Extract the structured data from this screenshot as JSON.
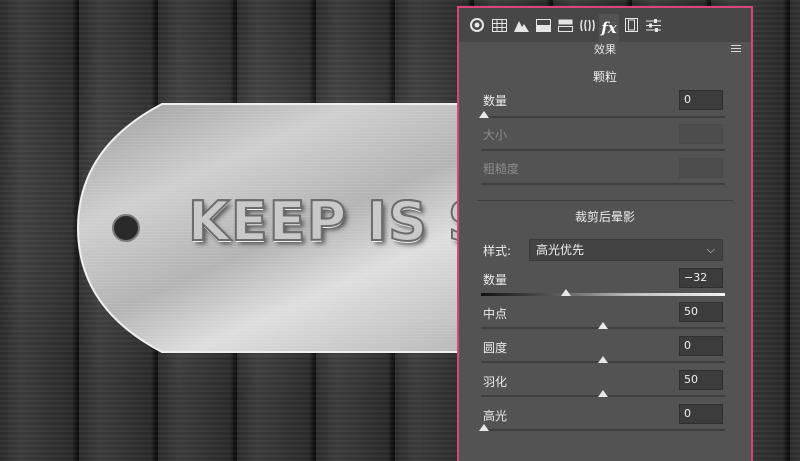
{
  "tag": {
    "text": "KEEP IS SI"
  },
  "panel": {
    "tabs": [
      "aperture-icon",
      "grid-icon",
      "mountain-icon",
      "hsl-icon",
      "split-tone-icon",
      "lens-icon",
      "fx-icon",
      "film-icon",
      "sliders-icon"
    ],
    "header_title": "效果",
    "grain": {
      "title": "颗粒",
      "amount_label": "数量",
      "amount_value": "0",
      "size_label": "大小",
      "roughness_label": "粗糙度"
    },
    "vignette": {
      "title": "裁剪后晕影",
      "style_label": "样式:",
      "style_value": "高光优先",
      "amount_label": "数量",
      "amount_value": "−32",
      "midpoint_label": "中点",
      "midpoint_value": "50",
      "roundness_label": "圆度",
      "roundness_value": "0",
      "feather_label": "羽化",
      "feather_value": "50",
      "highlights_label": "高光",
      "highlights_value": "0"
    }
  },
  "colors": {
    "panel_border": "#d8457a",
    "panel_bg": "#535353"
  }
}
